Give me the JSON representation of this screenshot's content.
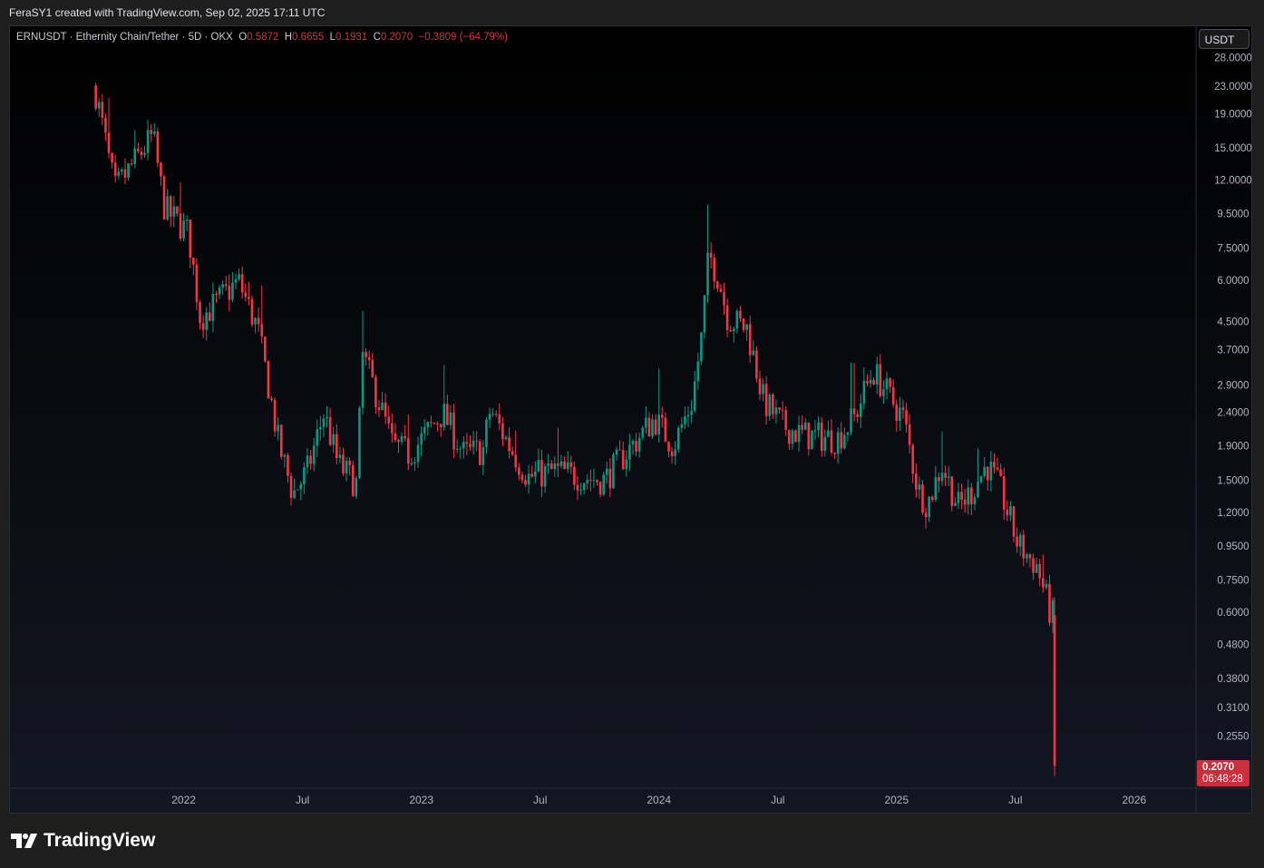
{
  "header": {
    "attribution": "FeraSY1 created with TradingView.com, Sep 02, 2025 17:11 UTC"
  },
  "legend": {
    "symbol": "ERNUSDT · Ethernity Chain/Tether · 5D · OKX",
    "o_label": "O",
    "o": "0.5872",
    "h_label": "H",
    "h": "0.6655",
    "l_label": "L",
    "l": "0.1931",
    "c_label": "C",
    "c": "0.2070",
    "change": "−0.3809 (−64.79%)"
  },
  "currency_button": "USDT",
  "last_price": {
    "value": "0.2070",
    "countdown": "06:48:28"
  },
  "footer": {
    "brand": "TradingView"
  },
  "colors": {
    "up": "#089981",
    "down": "#f23645",
    "last": "#c8303c"
  },
  "chart_data": {
    "type": "candlestick",
    "title": "ERNUSDT · Ethernity Chain/Tether · 5D · OKX",
    "scale": "log",
    "interval_days": 5,
    "ylim": [
      0.19,
      30
    ],
    "y_ticks": [
      "28.0000",
      "23.0000",
      "19.0000",
      "15.0000",
      "12.0000",
      "9.5000",
      "7.5000",
      "6.0000",
      "4.5000",
      "3.7000",
      "2.9000",
      "2.4000",
      "1.9000",
      "1.5000",
      "1.2000",
      "0.9500",
      "0.7500",
      "0.6000",
      "0.4800",
      "0.3800",
      "0.3100",
      "0.2550"
    ],
    "x_ticks": [
      {
        "label": "2022",
        "t": 2022.0
      },
      {
        "label": "Jul",
        "t": 2022.5
      },
      {
        "label": "2023",
        "t": 2023.0
      },
      {
        "label": "Jul",
        "t": 2023.5
      },
      {
        "label": "2024",
        "t": 2024.0
      },
      {
        "label": "Jul",
        "t": 2024.5
      },
      {
        "label": "2025",
        "t": 2025.0
      },
      {
        "label": "Jul",
        "t": 2025.5
      },
      {
        "label": "2026",
        "t": 2026.0
      }
    ],
    "xlim": [
      2021.265,
      2026.26
    ],
    "close_path_estimated": [
      [
        2021.63,
        22
      ],
      [
        2021.71,
        11.2
      ],
      [
        2021.87,
        16.3
      ],
      [
        2021.92,
        9.8
      ],
      [
        2022.02,
        8.3
      ],
      [
        2022.07,
        4.6
      ],
      [
        2022.23,
        5.95
      ],
      [
        2022.31,
        4.3
      ],
      [
        2022.36,
        2.8
      ],
      [
        2022.4,
        1.92
      ],
      [
        2022.46,
        1.36
      ],
      [
        2022.52,
        1.6
      ],
      [
        2022.59,
        2.39
      ],
      [
        2022.65,
        1.67
      ],
      [
        2022.73,
        1.45
      ],
      [
        2022.75,
        3.6
      ],
      [
        2022.82,
        2.6
      ],
      [
        2022.88,
        1.9
      ],
      [
        2022.95,
        1.79
      ],
      [
        2023.09,
        2.39
      ],
      [
        2023.18,
        1.79
      ],
      [
        2023.26,
        1.85
      ],
      [
        2023.29,
        2.45
      ],
      [
        2023.37,
        1.9
      ],
      [
        2023.45,
        1.53
      ],
      [
        2023.56,
        1.6
      ],
      [
        2023.68,
        1.53
      ],
      [
        2023.77,
        1.5
      ],
      [
        2023.87,
        1.84
      ],
      [
        2023.98,
        2.3
      ],
      [
        2024.06,
        1.9
      ],
      [
        2024.14,
        2.6
      ],
      [
        2024.18,
        4.1
      ],
      [
        2024.21,
        7.2
      ],
      [
        2024.25,
        6.1
      ],
      [
        2024.29,
        4.6
      ],
      [
        2024.37,
        4.3
      ],
      [
        2024.44,
        2.6
      ],
      [
        2024.52,
        2.2
      ],
      [
        2024.6,
        2.05
      ],
      [
        2024.75,
        2.0
      ],
      [
        2024.82,
        2.3
      ],
      [
        2024.9,
        3.2
      ],
      [
        2024.98,
        2.6
      ],
      [
        2025.03,
        2.3
      ],
      [
        2025.09,
        1.4
      ],
      [
        2025.13,
        1.27
      ],
      [
        2025.19,
        1.67
      ],
      [
        2025.26,
        1.25
      ],
      [
        2025.32,
        1.4
      ],
      [
        2025.38,
        1.67
      ],
      [
        2025.44,
        1.38
      ],
      [
        2025.51,
        0.96
      ],
      [
        2025.59,
        0.83
      ],
      [
        2025.65,
        0.5872
      ]
    ],
    "last_candle": {
      "t": 2025.665,
      "open": 0.5872,
      "high": 0.6655,
      "low": 0.1931,
      "close": 0.207
    }
  }
}
